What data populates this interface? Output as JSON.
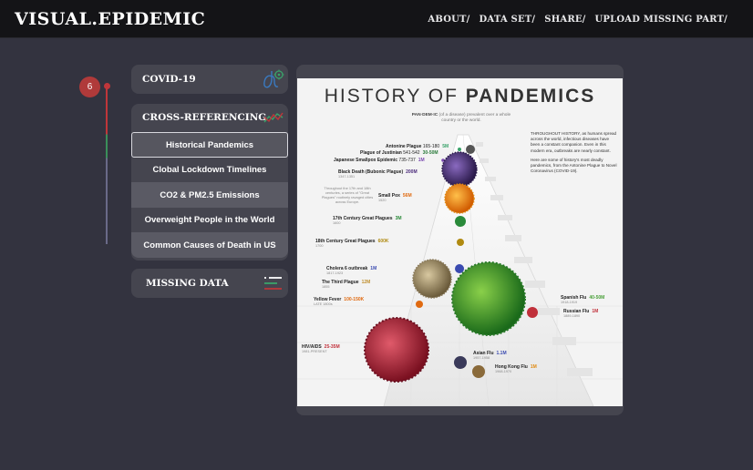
{
  "app": {
    "title": "VISUAL.EPIDEMIC"
  },
  "nav": [
    "ABOUT/",
    "DATA SET/",
    "SHARE/",
    "UPLOAD MISSING PART/"
  ],
  "step": {
    "number": "6"
  },
  "sidebar": {
    "covid": {
      "title": "COVID-19"
    },
    "cross": {
      "title": "CROSS-REFERENCING",
      "items": [
        "Historical Pandemics",
        "Clobal Lockdown Timelines",
        "CO2 & PM2.5 Emissions",
        "Overweight People in the World",
        "Common Causes of Death in US"
      ],
      "active_index": 0
    },
    "missing": {
      "title": "MISSING DATA"
    }
  },
  "icons": {
    "covid": "lungs-virus-icon",
    "cross": "trend-lines-icon",
    "missing": "list-lines-icon",
    "accent_red": "#c0363a",
    "accent_green": "#3a8f5a"
  },
  "poster": {
    "title_light": "HISTORY OF ",
    "title_bold": "PANDEMICS",
    "definition_term": "PAN·DEM·IC",
    "definition_text": "(of a disease) prevalent over a whole country or the world.",
    "intro_1": "THROUGHOUT HISTORY, as humans spread across the world, infectious diseases have been a constant companion. Even in this modern era, outbreaks are nearly constant.",
    "intro_2": "Here are some of history's most deadly pandemics, from the Antonine Plague to Novel Coronavirus (COVID-19).",
    "side_note": "Throughout the 17th and 18th centuries, a series of \"Great Plagues\" routinely ravaged cities across Europe.",
    "pandemics": [
      {
        "name": "Antonine Plague",
        "years": "165-180",
        "deaths": "5M",
        "color": "#3aa36a"
      },
      {
        "name": "Plague of Justinian",
        "years": "541-542",
        "deaths": "30-50M",
        "color": "#2a7a3a"
      },
      {
        "name": "Japanese Smallpox Epidemic",
        "years": "735-737",
        "deaths": "1M",
        "color": "#7a4ab0"
      },
      {
        "name": "Black Death (Bubonic Plague)",
        "years": "1347-1351",
        "deaths": "200M",
        "color": "#4a2a7a"
      },
      {
        "name": "Small Pox",
        "years": "1520",
        "deaths": "56M",
        "color": "#e06a10"
      },
      {
        "name": "17th Century Great Plagues",
        "years": "1600",
        "deaths": "3M",
        "color": "#2a8a3a"
      },
      {
        "name": "18th Century Great Plagues",
        "years": "1700",
        "deaths": "600K",
        "color": "#b08a10"
      },
      {
        "name": "Cholera 6 outbreak",
        "years": "1817-1923",
        "deaths": "1M",
        "color": "#3a4ab0"
      },
      {
        "name": "The Third Plague",
        "years": "1855",
        "deaths": "12M",
        "color": "#c09030"
      },
      {
        "name": "Yellow Fever",
        "years": "LATE 1800s",
        "deaths": "100-150K",
        "color": "#e06a10"
      },
      {
        "name": "Spanish Flu",
        "years": "1918-1919",
        "deaths": "40-50M",
        "color": "#4aa03a"
      },
      {
        "name": "Russian Flu",
        "years": "1889-1890",
        "deaths": "1M",
        "color": "#c0303a"
      },
      {
        "name": "HIV/AIDS",
        "years": "1981-PRESENT",
        "deaths": "25-35M",
        "color": "#c0303a"
      },
      {
        "name": "Asian Flu",
        "years": "1957-1958",
        "deaths": "1.1M",
        "color": "#3a4ab0"
      },
      {
        "name": "Hong Kong Flu",
        "years": "1968-1970",
        "deaths": "1M",
        "color": "#e08a10"
      }
    ]
  }
}
